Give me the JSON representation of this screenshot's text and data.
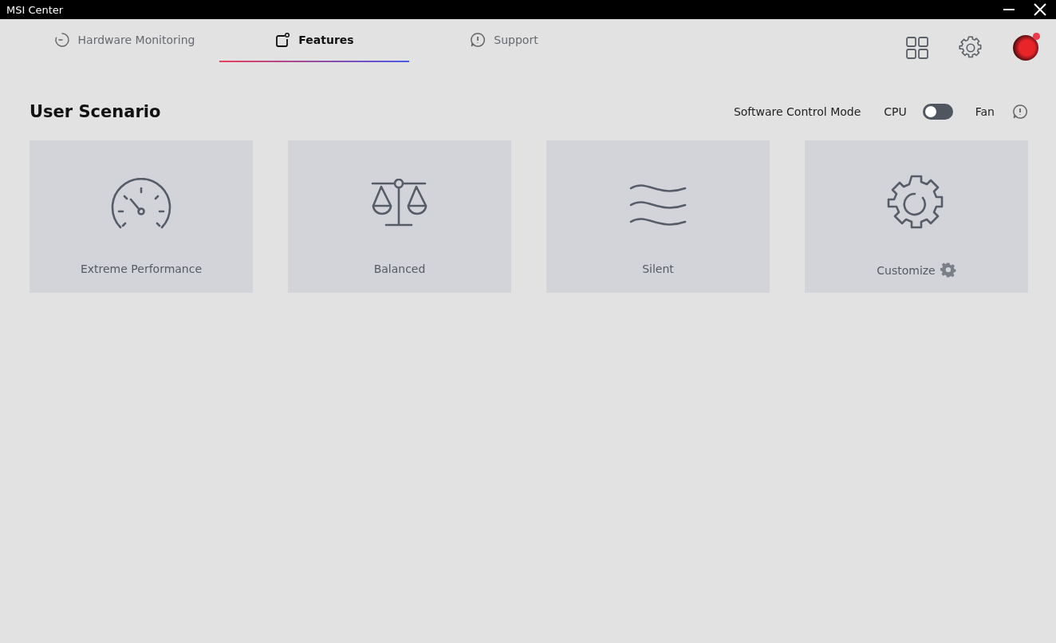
{
  "window": {
    "title": "MSI Center"
  },
  "tabs": [
    {
      "label": "Hardware Monitoring",
      "kind": "monitor",
      "selected": false
    },
    {
      "label": "Features",
      "kind": "features",
      "selected": true
    },
    {
      "label": "Support",
      "kind": "support",
      "selected": false
    }
  ],
  "account": {
    "notification": true
  },
  "section": {
    "title": "User Scenario"
  },
  "control_mode": {
    "label": "Software Control Mode",
    "left_label": "CPU",
    "right_label": "Fan",
    "on": false
  },
  "scenarios": [
    {
      "label": "Extreme Performance",
      "kind": "speedometer"
    },
    {
      "label": "Balanced",
      "kind": "scale"
    },
    {
      "label": "Silent",
      "kind": "waves"
    },
    {
      "label": "Customize",
      "kind": "gear"
    }
  ]
}
